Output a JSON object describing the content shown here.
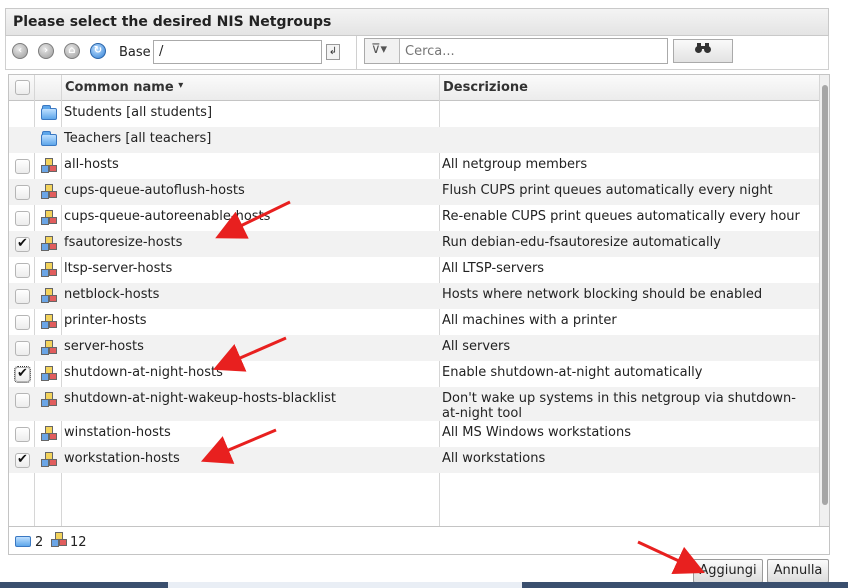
{
  "dialog": {
    "title": "Please select the desired NIS Netgroups"
  },
  "toolbar": {
    "nav_icons": [
      "back-icon",
      "forward-icon",
      "home-icon",
      "reload-icon"
    ],
    "base_label": "Base",
    "base_value": "/",
    "filter_placeholder": "Cerca..."
  },
  "table": {
    "columns": [
      "Common name",
      "Descrizione"
    ],
    "sort_indicator": "▾",
    "rows": [
      {
        "type": "folder",
        "name": "Students [all students]",
        "desc": "",
        "checkbox": false,
        "checked": false
      },
      {
        "type": "folder",
        "name": "Teachers [all teachers]",
        "desc": "",
        "checkbox": false,
        "checked": false
      },
      {
        "type": "group",
        "name": "all-hosts",
        "desc": "All netgroup members",
        "checkbox": true,
        "checked": false
      },
      {
        "type": "group",
        "name": "cups-queue-autoflush-hosts",
        "desc": "Flush CUPS print queues automatically every night",
        "checkbox": true,
        "checked": false
      },
      {
        "type": "group",
        "name": "cups-queue-autoreenable-hosts",
        "desc": "Re-enable CUPS print queues automatically every hour",
        "checkbox": true,
        "checked": false
      },
      {
        "type": "group",
        "name": "fsautoresize-hosts",
        "desc": "Run debian-edu-fsautoresize automatically",
        "checkbox": true,
        "checked": true
      },
      {
        "type": "group",
        "name": "ltsp-server-hosts",
        "desc": "All LTSP-servers",
        "checkbox": true,
        "checked": false
      },
      {
        "type": "group",
        "name": "netblock-hosts",
        "desc": "Hosts where network blocking should be enabled",
        "checkbox": true,
        "checked": false
      },
      {
        "type": "group",
        "name": "printer-hosts",
        "desc": "All machines with a printer",
        "checkbox": true,
        "checked": false
      },
      {
        "type": "group",
        "name": "server-hosts",
        "desc": "All servers",
        "checkbox": true,
        "checked": false
      },
      {
        "type": "group",
        "name": "shutdown-at-night-hosts",
        "desc": "Enable shutdown-at-night automatically",
        "checkbox": true,
        "checked": true
      },
      {
        "type": "group",
        "name": "shutdown-at-night-wakeup-hosts-blacklist",
        "desc": "Don't wake up systems in this netgroup via shutdown-at-night tool",
        "checkbox": true,
        "checked": false
      },
      {
        "type": "group",
        "name": "winstation-hosts",
        "desc": "All MS Windows workstations",
        "checkbox": true,
        "checked": false
      },
      {
        "type": "group",
        "name": "workstation-hosts",
        "desc": "All workstations",
        "checkbox": true,
        "checked": true
      }
    ]
  },
  "footer": {
    "folder_count": "2",
    "group_count": "12"
  },
  "buttons": {
    "add": "Aggiungi",
    "cancel": "Annulla"
  },
  "colors": {
    "arrow": "#e8201f",
    "row_alt": "#f2f2f2"
  }
}
